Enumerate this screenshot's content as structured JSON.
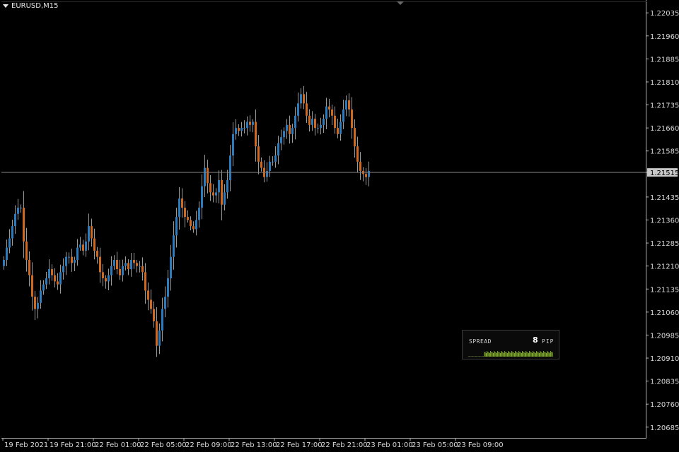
{
  "window": {
    "title": "EURUSD,M15"
  },
  "current_price": "1.21515",
  "spread": {
    "label": "SPREAD",
    "value": "8",
    "unit": "PIP"
  },
  "colors": {
    "background": "#000000",
    "bull": "#2b7bbd",
    "bear": "#d0691e",
    "wick": "#9a9a9a",
    "grid_line": "#7a7a7a",
    "spread_bar": "#9acd32",
    "axis_text": "#d8d8d8"
  },
  "chart_data": {
    "type": "candlestick",
    "symbol": "EURUSD",
    "timeframe": "M15",
    "ylim": [
      1.2065,
      1.2207
    ],
    "y_ticks": [
      "1.22035",
      "1.21960",
      "1.21885",
      "1.21810",
      "1.21735",
      "1.21660",
      "1.21585",
      "1.21515",
      "1.21435",
      "1.21360",
      "1.21285",
      "1.21210",
      "1.21135",
      "1.21060",
      "1.20985",
      "1.20910",
      "1.20835",
      "1.20760",
      "1.20685"
    ],
    "x_ticks": [
      "19 Feb 2021",
      "19 Feb 21:00",
      "22 Feb 01:00",
      "22 Feb 05:00",
      "22 Feb 09:00",
      "22 Feb 13:00",
      "22 Feb 17:00",
      "22 Feb 21:00",
      "23 Feb 01:00",
      "23 Feb 05:00",
      "23 Feb 09:00"
    ],
    "last_price": 1.21515,
    "closes": [
      1.2123,
      1.2127,
      1.213,
      1.2134,
      1.2138,
      1.214,
      1.214,
      1.2129,
      1.2123,
      1.2118,
      1.2111,
      1.2107,
      1.2109,
      1.2113,
      1.2115,
      1.2117,
      1.212,
      1.2118,
      1.2116,
      1.2115,
      1.2119,
      1.2121,
      1.2124,
      1.2124,
      1.2122,
      1.2123,
      1.2127,
      1.2128,
      1.2126,
      1.2129,
      1.2134,
      1.213,
      1.2126,
      1.2124,
      1.2119,
      1.2117,
      1.2116,
      1.2118,
      1.2121,
      1.2123,
      1.212,
      1.2118,
      1.2121,
      1.2122,
      1.212,
      1.2123,
      1.2122,
      1.2121,
      1.2121,
      1.2119,
      1.2113,
      1.211,
      1.2107,
      1.2103,
      1.2095,
      1.21,
      1.2107,
      1.2111,
      1.2117,
      1.2124,
      1.2131,
      1.2137,
      1.2143,
      1.214,
      1.2137,
      1.2136,
      1.2134,
      1.2133,
      1.2136,
      1.214,
      1.2147,
      1.2153,
      1.2148,
      1.2145,
      1.2144,
      1.2145,
      1.2149,
      1.2141,
      1.2145,
      1.2149,
      1.2157,
      1.2164,
      1.2166,
      1.2165,
      1.2166,
      1.2166,
      1.2168,
      1.2167,
      1.2168,
      1.216,
      1.2155,
      1.2153,
      1.215,
      1.2152,
      1.2155,
      1.2155,
      1.2157,
      1.2161,
      1.2163,
      1.2165,
      1.2167,
      1.2164,
      1.2166,
      1.217,
      1.2174,
      1.2177,
      1.2174,
      1.217,
      1.2167,
      1.2169,
      1.2166,
      1.2166,
      1.2167,
      1.2169,
      1.2173,
      1.2172,
      1.217,
      1.2166,
      1.2164,
      1.2168,
      1.2172,
      1.2175,
      1.2172,
      1.2166,
      1.216,
      1.2155,
      1.2152,
      1.2151,
      1.215,
      1.2152
    ]
  }
}
